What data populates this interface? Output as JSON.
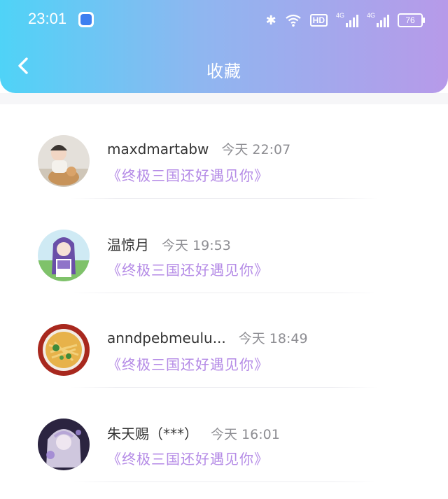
{
  "status_bar": {
    "time": "23:01",
    "battery": "76",
    "hd_label": "HD",
    "signal_label_1": "4G",
    "signal_label_2": "4G"
  },
  "header": {
    "title": "收藏"
  },
  "favorites": [
    {
      "name": "maxdmartabw",
      "time": "今天 22:07",
      "book": "《终极三国还好遇见你》"
    },
    {
      "name": "温惊月",
      "time": "今天 19:53",
      "book": "《终极三国还好遇见你》"
    },
    {
      "name": "anndpebmeulu...",
      "time": "今天 18:49",
      "book": "《终极三国还好遇见你》"
    },
    {
      "name": "朱天赐（***）",
      "time": "今天 16:01",
      "book": "《终极三国还好遇见你》"
    }
  ],
  "colors": {
    "header_gradient_start": "#4fd3f7",
    "header_gradient_end": "#b79ae9",
    "link_color": "#b48ae6"
  }
}
